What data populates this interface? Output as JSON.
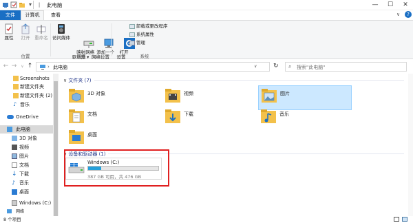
{
  "window": {
    "title": "此电脑"
  },
  "tabs": {
    "file": "文件",
    "computer": "计算机",
    "view": "查看"
  },
  "ribbon": {
    "location": {
      "properties": "属性",
      "open": "打开",
      "rename": "重命名",
      "group": "位置"
    },
    "network": {
      "access_media": "访问媒体",
      "map_drive": "映射网络\n驱动器 ▾",
      "add_location": "添加一个\n网络位置",
      "group": "网络"
    },
    "system": {
      "open_settings": "打开\n设置",
      "uninstall": "卸载或更改程序",
      "sys_props": "系统属性",
      "manage": "管理",
      "group": "系统"
    }
  },
  "address": {
    "path": "此电脑",
    "search_placeholder": "搜索\"此电脑\""
  },
  "sidebar": {
    "items": [
      {
        "label": "Screenshots"
      },
      {
        "label": "新建文件夹"
      },
      {
        "label": "新建文件夹 (2)"
      },
      {
        "label": "音乐"
      },
      {
        "label": "OneDrive"
      },
      {
        "label": "此电脑"
      },
      {
        "label": "3D 对象"
      },
      {
        "label": "视频"
      },
      {
        "label": "图片"
      },
      {
        "label": "文档"
      },
      {
        "label": "下载"
      },
      {
        "label": "音乐"
      },
      {
        "label": "桌面"
      },
      {
        "label": "Windows (C:)"
      },
      {
        "label": "网络"
      }
    ]
  },
  "content": {
    "folders_header": "文件夹 (7)",
    "folders": [
      {
        "label": "3D 对象"
      },
      {
        "label": "视频"
      },
      {
        "label": "图片"
      },
      {
        "label": "文档"
      },
      {
        "label": "下载"
      },
      {
        "label": "音乐"
      },
      {
        "label": "桌面"
      }
    ],
    "drives_header": "设备和驱动器 (1)",
    "drive": {
      "name": "Windows (C:)",
      "space": "387 GB 可用，共 476 GB",
      "used_fraction": 0.19
    }
  },
  "status": {
    "count": "8 个项目"
  },
  "colors": {
    "accent": "#1a6fc4",
    "folder": "#f3c14b",
    "highlight": "#cce8ff",
    "annotation": "#e02020",
    "drive_bar": "#26a0da"
  }
}
